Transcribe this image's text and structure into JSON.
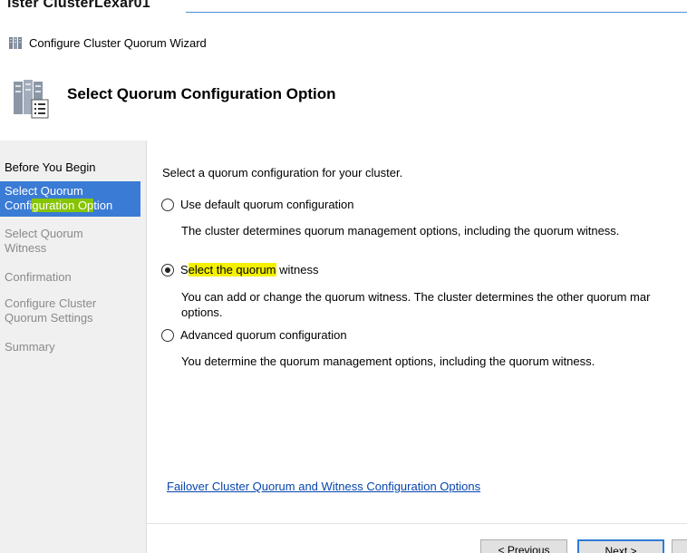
{
  "header_top": {
    "cluster_title": "ister ClusterLexar01"
  },
  "window": {
    "title": "Configure Cluster Quorum Wizard",
    "icon": "wizard-window-icon"
  },
  "page": {
    "heading": "Select Quorum Configuration Option",
    "icon": "cluster-server-icon"
  },
  "sidebar": {
    "items": [
      {
        "line1": "Before You Begin",
        "line2": "",
        "state": "done"
      },
      {
        "line1": "Select Quorum",
        "line2_plain": "Confi",
        "line2_highlight": "guration Op",
        "line2_rest": "tion",
        "state": "active"
      },
      {
        "line1": "Select Quorum",
        "line2": "Witness",
        "state": "pending"
      },
      {
        "line1": "Confirmation",
        "line2": "",
        "state": "pending"
      },
      {
        "line1": "Configure Cluster",
        "line2": "Quorum Settings",
        "state": "pending"
      },
      {
        "line1": "Summary",
        "line2": "",
        "state": "pending"
      }
    ]
  },
  "main": {
    "prompt": "Select a quorum configuration for your cluster.",
    "options": [
      {
        "label": "Use default quorum configuration",
        "description": "The cluster determines quorum management options, including the quorum witness.",
        "checked": false
      },
      {
        "label_pre": "S",
        "label_highlight": "elect the quorum",
        "label_post": " witness",
        "description_line1": "You can add or change the quorum witness. The cluster determines the other quorum mar",
        "description_line2": "options.",
        "checked": true
      },
      {
        "label": "Advanced quorum configuration",
        "description": "You determine the quorum management options, including the quorum witness.",
        "checked": false
      }
    ],
    "help_link": "Failover Cluster Quorum and Witness Configuration Options"
  },
  "buttons": {
    "previous": "< Previous",
    "next": "Next >",
    "extra": ""
  },
  "colors": {
    "active_item": "#3a7bd5",
    "highlight_green": "#86c400",
    "highlight_yellow": "#f4f000",
    "link": "#0645ad",
    "next_border": "#2f7cd7"
  }
}
